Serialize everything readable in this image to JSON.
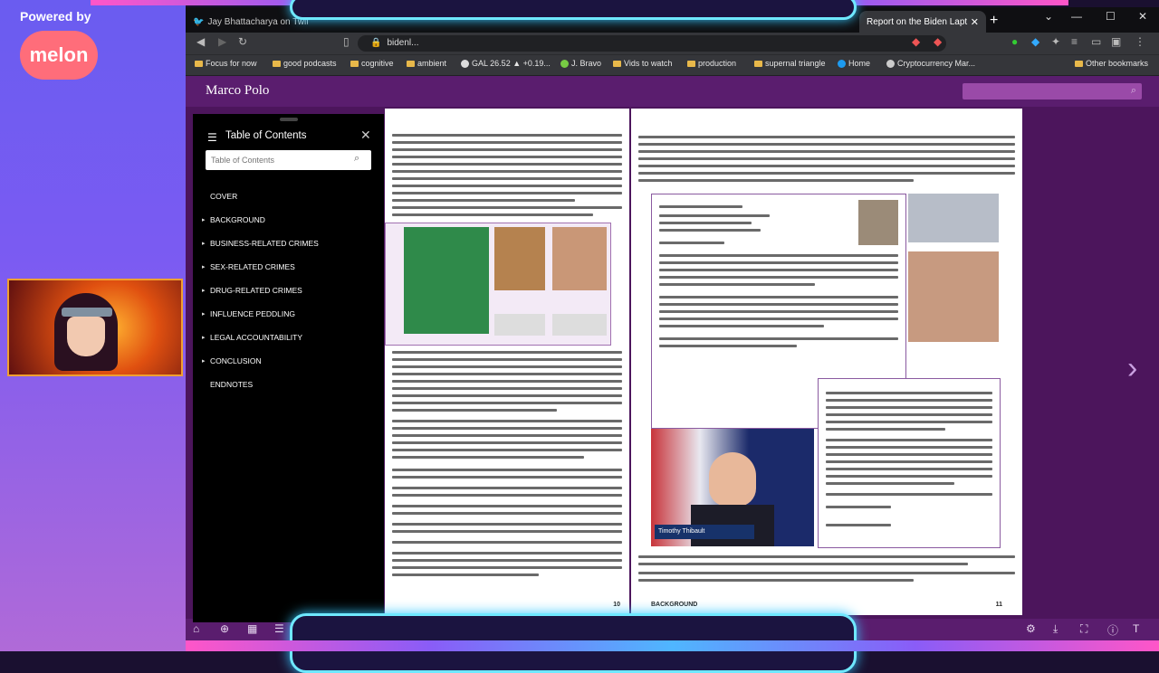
{
  "overlay": {
    "powered_by": "Powered by",
    "brand": "melon"
  },
  "browser": {
    "tabs": [
      {
        "label": "Jay Bhattacharya on Twitter:"
      },
      {
        "label": "Report on the Biden Lapt"
      }
    ],
    "new_tab": "+",
    "window_controls": {
      "minimize": "—",
      "maximize": "☐",
      "close": "✕"
    },
    "url": "bidenl...",
    "bookmarks": [
      {
        "label": "Focus for now",
        "icon": "folder-icon"
      },
      {
        "label": "good podcasts",
        "icon": "folder-icon"
      },
      {
        "label": "cognitive",
        "icon": "folder-icon"
      },
      {
        "label": "ambient",
        "icon": "folder-icon"
      },
      {
        "label": "GAL 26.52 ▲ +0.19...",
        "icon": "ticker-icon"
      },
      {
        "label": "J. Bravo",
        "icon": "site-icon"
      },
      {
        "label": "Vids to watch",
        "icon": "folder-icon"
      },
      {
        "label": "production",
        "icon": "folder-icon"
      },
      {
        "label": "supernal triangle",
        "icon": "folder-icon"
      },
      {
        "label": "Home",
        "icon": "twitter-icon"
      },
      {
        "label": "Cryptocurrency Mar...",
        "icon": "site-icon"
      },
      {
        "label": "Other bookmarks",
        "icon": "folder-icon"
      }
    ]
  },
  "reader": {
    "logo": "Marco Polo",
    "page_left_number": "10",
    "page_right_number": "11",
    "page_right_section": "BACKGROUND",
    "toc": {
      "title": "Table of Contents",
      "search_placeholder": "Table of Contents",
      "items": [
        {
          "label": "COVER",
          "expandable": false
        },
        {
          "label": "BACKGROUND",
          "expandable": true
        },
        {
          "label": "BUSINESS-RELATED CRIMES",
          "expandable": true
        },
        {
          "label": "SEX-RELATED CRIMES",
          "expandable": true
        },
        {
          "label": "DRUG-RELATED CRIMES",
          "expandable": true
        },
        {
          "label": "INFLUENCE PEDDLING",
          "expandable": true
        },
        {
          "label": "LEGAL ACCOUNTABILITY",
          "expandable": true
        },
        {
          "label": "CONCLUSION",
          "expandable": true
        },
        {
          "label": "ENDNOTES",
          "expandable": false
        }
      ]
    },
    "photo_caption": "Timothy Thibault"
  },
  "colors": {
    "reader_purple": "#5a1d6e",
    "brand_melon": "#ff6d7a",
    "neon_cyan": "#6fe8ff"
  }
}
